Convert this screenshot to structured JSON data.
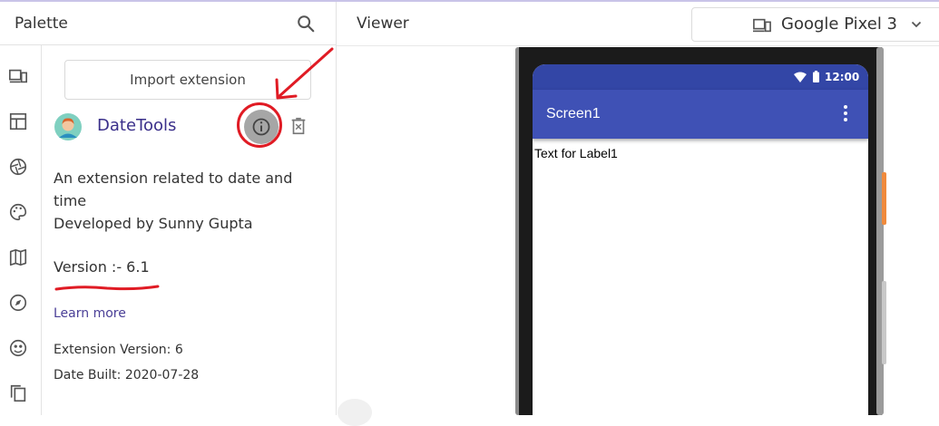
{
  "palette": {
    "title": "Palette",
    "search_icon": "search-icon",
    "rail_icons": [
      "devices-icon",
      "layout-icon",
      "media-icon",
      "palette-icon",
      "map-icon",
      "compass-icon",
      "social-icon",
      "copy-icon"
    ]
  },
  "extension": {
    "import_label": "Import extension",
    "name": "DateTools",
    "avatar_icon": "avatar",
    "info_icon": "info-icon",
    "delete_icon": "delete-icon",
    "description_line1": "An extension related to date and time",
    "description_line2": "Developed by Sunny Gupta",
    "version_text": "Version :- 6.1",
    "learn_more": "Learn more",
    "extension_version": "Extension Version: 6",
    "date_built": "Date Built: 2020-07-28"
  },
  "viewer": {
    "title": "Viewer",
    "device_icon": "device-icon",
    "device_name": "Google Pixel 3"
  },
  "phone": {
    "status_time": "12:00",
    "screen_title": "Screen1",
    "label_text": "Text for Label1"
  },
  "colors": {
    "accent": "#3f51b5",
    "status_bar": "#3346a6",
    "annotation_red": "#e01b24",
    "link_purple": "#4a3f97"
  }
}
